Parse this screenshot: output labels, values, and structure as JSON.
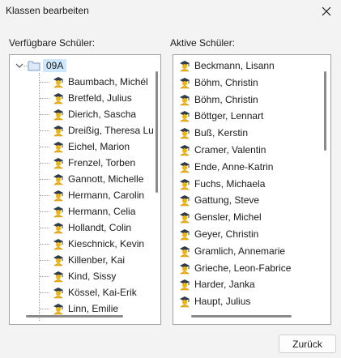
{
  "window": {
    "title": "Klassen bearbeiten",
    "close_symbol": "✕"
  },
  "left_panel": {
    "label": "Verfügbare Schüler:",
    "class_node": "09A",
    "students": [
      "Baumbach, Michél",
      "Bretfeld, Julius",
      "Dierich, Sascha",
      "Dreißig, Theresa Lu",
      "Eichel, Marion",
      "Frenzel, Torben",
      "Gannott, Michelle",
      "Hermann, Carolin",
      "Hermann, Celia",
      "Hollandt, Colin",
      "Kieschnick, Kevin",
      "Killenber, Kai",
      "Kind, Sissy",
      "Kössel, Kai-Erik",
      "Linn, Emilie"
    ]
  },
  "right_panel": {
    "label": "Aktive Schüler:",
    "students": [
      "Beckmann, Lisann",
      "Böhm, Christin",
      "Böhm, Christin",
      "Böttger, Lennart",
      "Buß, Kerstin",
      "Cramer, Valentin",
      "Ende, Anne-Katrin",
      "Fuchs, Michaela",
      "Gattung, Steve",
      "Gensler, Michel",
      "Geyer, Christin",
      "Gramlich, Annemarie",
      "Grieche, Leon-Fabrice",
      "Harder, Janka",
      "Haupt, Julius"
    ]
  },
  "footer": {
    "back_label": "Zurück"
  },
  "icons": {
    "student": "student-graduate-icon",
    "folder": "folder-icon",
    "expander": "chevron-down-icon"
  },
  "colors": {
    "selection": "#cce8ff",
    "icon_cap": "#2f3b4a",
    "icon_face": "#f4b400"
  }
}
